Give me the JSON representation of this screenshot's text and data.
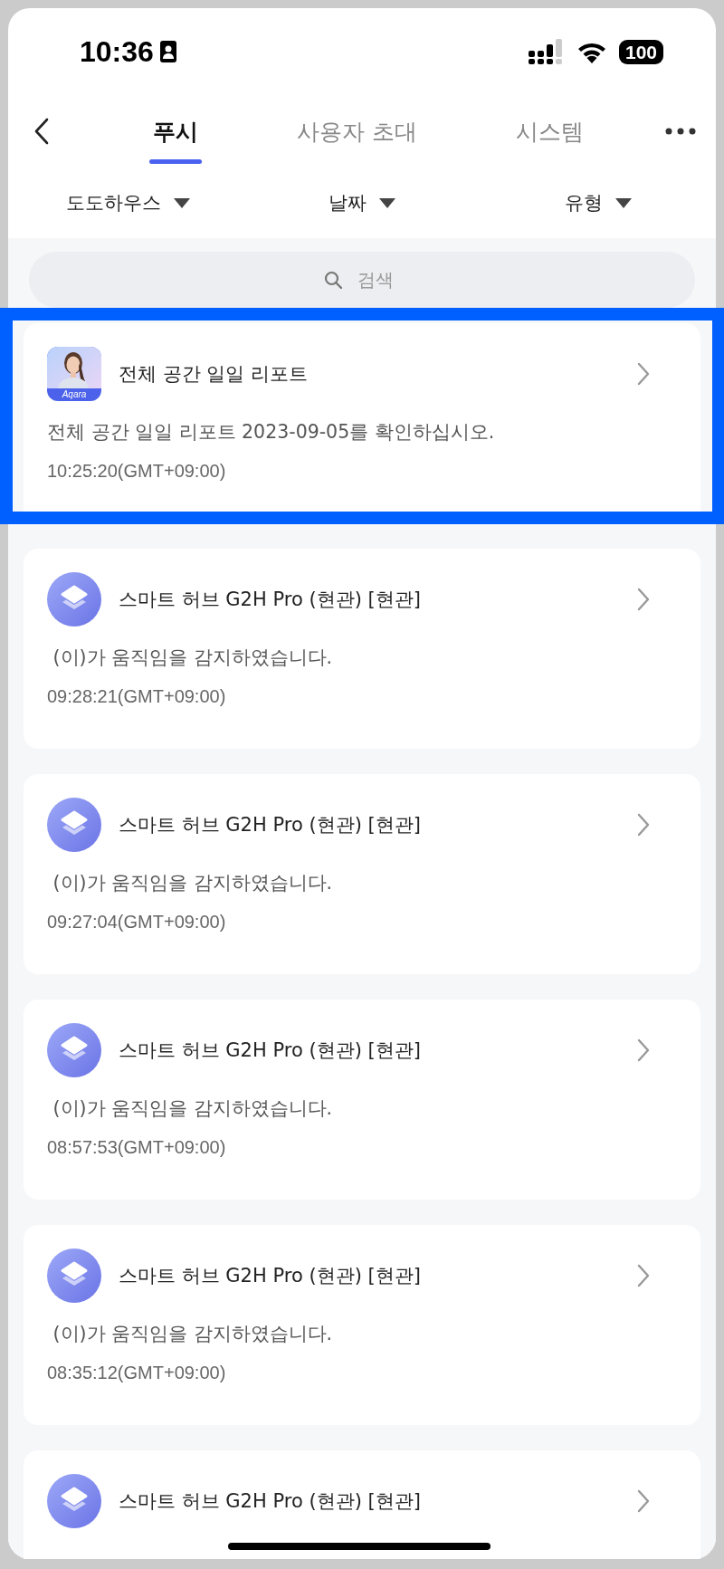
{
  "status_bar": {
    "time": "10:36",
    "battery": "100"
  },
  "tabs": [
    {
      "label": "푸시",
      "selected": true
    },
    {
      "label": "사용자 초대",
      "selected": false
    },
    {
      "label": "시스템",
      "selected": false
    }
  ],
  "filters": [
    "도도하우스",
    "날짜",
    "유형"
  ],
  "search": {
    "placeholder": "검색"
  },
  "notifications": [
    {
      "kind": "report",
      "icon_label": "Aqara",
      "title": "전체 공간 일일 리포트",
      "message": "전체 공간 일일 리포트 2023-09-05를 확인하십시오.",
      "time": "10:25:20(GMT+09:00)",
      "highlighted": true
    },
    {
      "kind": "hub",
      "title": "스마트 허브 G2H Pro (현관) [현관]",
      "message": " (이)가 움직임을 감지하였습니다.",
      "time": "09:28:21(GMT+09:00)",
      "highlighted": false
    },
    {
      "kind": "hub",
      "title": "스마트 허브 G2H Pro (현관) [현관]",
      "message": " (이)가 움직임을 감지하였습니다.",
      "time": "09:27:04(GMT+09:00)",
      "highlighted": false
    },
    {
      "kind": "hub",
      "title": "스마트 허브 G2H Pro (현관) [현관]",
      "message": " (이)가 움직임을 감지하였습니다.",
      "time": "08:57:53(GMT+09:00)",
      "highlighted": false
    },
    {
      "kind": "hub",
      "title": "스마트 허브 G2H Pro (현관) [현관]",
      "message": " (이)가 움직임을 감지하였습니다.",
      "time": "08:35:12(GMT+09:00)",
      "highlighted": false
    },
    {
      "kind": "hub",
      "title": "스마트 허브 G2H Pro (현관) [현관]",
      "highlighted": false
    }
  ]
}
